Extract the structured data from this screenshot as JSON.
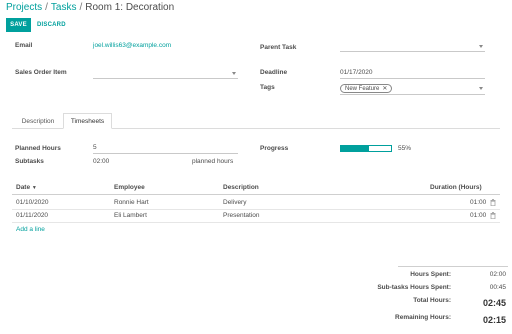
{
  "breadcrumb": {
    "projects": "Projects",
    "tasks": "Tasks",
    "current": "Room 1: Decoration",
    "separator": "/"
  },
  "actions": {
    "save": "SAVE",
    "discard": "DISCARD"
  },
  "form": {
    "email_label": "Email",
    "email_value": "joel.willis63@example.com",
    "parent_task_label": "Parent Task",
    "parent_task_value": "",
    "sales_order_item_label": "Sales Order Item",
    "sales_order_item_value": "",
    "deadline_label": "Deadline",
    "deadline_value": "01/17/2020",
    "tags_label": "Tags",
    "tags": [
      "New Feature"
    ]
  },
  "tabs": [
    {
      "label": "Description",
      "active": false
    },
    {
      "label": "Timesheets",
      "active": true
    }
  ],
  "timesheet_summary": {
    "planned_hours_label": "Planned Hours",
    "planned_hours_value": "5",
    "subtasks_label": "Subtasks",
    "subtasks_value": "02:00",
    "subtasks_suffix": "planned hours",
    "progress_label": "Progress",
    "progress_percent": 55,
    "progress_text": "55%"
  },
  "table": {
    "columns": [
      "Date",
      "Employee",
      "Description",
      "Duration (Hours)"
    ],
    "sort_indicator": "▼",
    "rows": [
      {
        "date": "01/10/2020",
        "employee": "Ronnie Hart",
        "description": "Delivery",
        "duration": "01:00"
      },
      {
        "date": "01/11/2020",
        "employee": "Eli Lambert",
        "description": "Presentation",
        "duration": "01:00"
      }
    ],
    "add_line": "Add a line"
  },
  "totals": {
    "hours_spent_label": "Hours Spent:",
    "hours_spent_value": "02:00",
    "subtasks_hours_label": "Sub-tasks Hours Spent:",
    "subtasks_hours_value": "00:45",
    "total_hours_label": "Total Hours:",
    "total_hours_value": "02:45",
    "remaining_hours_label": "Remaining Hours:",
    "remaining_hours_value": "02:15"
  },
  "colors": {
    "accent": "#00a09d",
    "text": "#4c4c4c",
    "border": "#dcdcdc"
  },
  "icons": {
    "trash": "trash-icon",
    "caret": "chevron-down-icon",
    "remove_tag": "close-icon"
  }
}
